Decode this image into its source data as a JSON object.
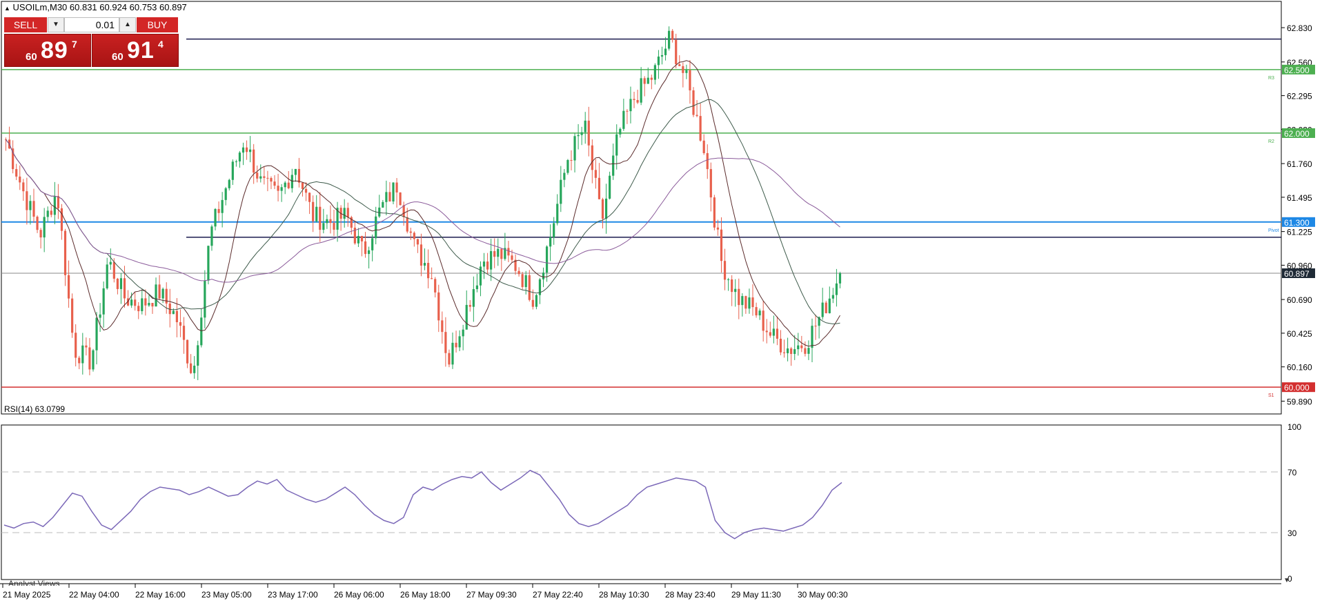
{
  "header": {
    "symbol_info": "USOILm,M30  60.831 60.924 60.753 60.897"
  },
  "trade_panel": {
    "sell_label": "SELL",
    "buy_label": "BUY",
    "lot_value": "0.01",
    "sell_price": {
      "prefix": "60",
      "big": "89",
      "sup": "7"
    },
    "buy_price": {
      "prefix": "60",
      "big": "91",
      "sup": "4"
    }
  },
  "rsi_panel": {
    "title": "RSI(14) 63.0799",
    "levels": [
      "100",
      "70",
      "30",
      "0"
    ]
  },
  "price_axis": {
    "ticks": [
      "62.830",
      "62.560",
      "62.295",
      "62.030",
      "61.760",
      "61.495",
      "61.225",
      "60.960",
      "60.690",
      "60.425",
      "60.160",
      "59.890"
    ],
    "current_label": "60.897"
  },
  "levels": [
    {
      "label": "62.500",
      "color": "#4caf50",
      "tag": "R3"
    },
    {
      "label": "62.000",
      "color": "#4caf50",
      "tag": "R2"
    },
    {
      "label": "61.300",
      "color": "#1e88e5",
      "tag": "Pivot"
    },
    {
      "label": "60.000",
      "color": "#d32f2f",
      "tag": "S1"
    }
  ],
  "time_axis": [
    "21 May 2025",
    "22 May 04:00",
    "22 May 16:00",
    "23 May 05:00",
    "23 May 17:00",
    "26 May 06:00",
    "26 May 18:00",
    "27 May 09:30",
    "27 May 22:40",
    "28 May 10:30",
    "28 May 23:40",
    "29 May 11:30",
    "30 May 00:30"
  ],
  "bottom_tab": "Analyst Views",
  "colors": {
    "bull": "#26a65b",
    "bear": "#e8604c",
    "rsi": "#7b68b8",
    "accent_red": "#d32626"
  },
  "chart_data": {
    "type": "candlestick",
    "symbol": "USOILm",
    "timeframe": "M30",
    "ohlc_current": {
      "open": 60.831,
      "high": 60.924,
      "low": 60.753,
      "close": 60.897
    },
    "ylim": [
      59.8,
      62.95
    ],
    "key_closes": [
      61.95,
      61.55,
      61.2,
      61.55,
      60.3,
      60.2,
      61.0,
      60.7,
      60.65,
      60.75,
      60.55,
      60.1,
      61.2,
      61.6,
      61.95,
      61.6,
      61.5,
      61.75,
      61.35,
      61.3,
      61.35,
      61.05,
      61.4,
      61.6,
      61.1,
      60.9,
      60.2,
      60.6,
      61.0,
      61.05,
      60.95,
      60.7,
      61.2,
      61.8,
      62.05,
      61.3,
      62.0,
      62.3,
      62.45,
      62.75,
      62.4,
      61.9,
      61.0,
      60.7,
      60.6,
      60.4,
      60.3,
      60.35,
      60.6,
      60.897
    ],
    "rsi": {
      "name": "RSI(14)",
      "last": 63.0799,
      "levels": [
        30,
        70
      ],
      "ylim": [
        0,
        100
      ],
      "values": [
        35,
        33,
        36,
        37,
        34,
        40,
        48,
        56,
        54,
        44,
        35,
        32,
        38,
        44,
        52,
        57,
        60,
        59,
        58,
        55,
        57,
        60,
        57,
        54,
        55,
        60,
        64,
        62,
        65,
        58,
        55,
        52,
        50,
        52,
        56,
        60,
        55,
        48,
        42,
        38,
        36,
        40,
        55,
        60,
        58,
        62,
        65,
        67,
        66,
        70,
        63,
        58,
        62,
        66,
        71,
        68,
        60,
        52,
        42,
        36,
        34,
        36,
        40,
        44,
        48,
        55,
        60,
        62,
        64,
        66,
        65,
        64,
        60,
        38,
        30,
        26,
        30,
        32,
        33,
        32,
        31,
        33,
        35,
        40,
        48,
        58,
        63
      ]
    }
  }
}
